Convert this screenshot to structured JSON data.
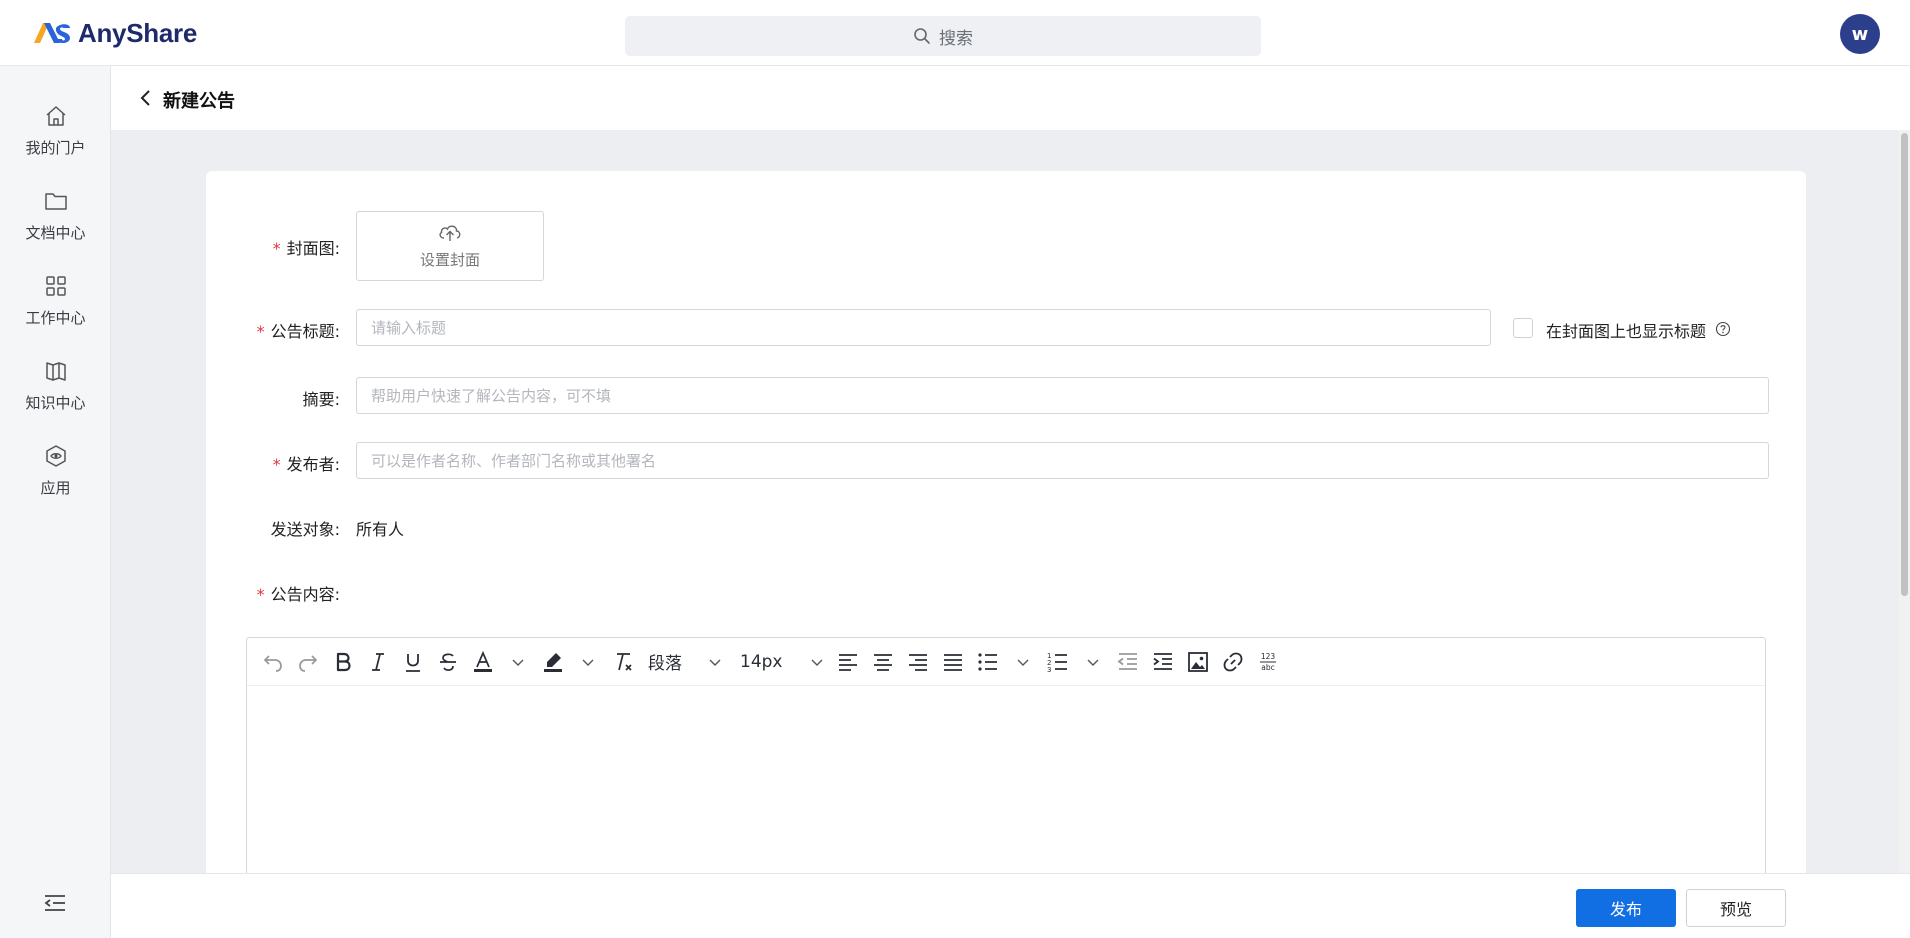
{
  "app": {
    "name": "AnyShare"
  },
  "search": {
    "placeholder": "搜索"
  },
  "user": {
    "avatar_letter": "w",
    "avatar_color": "#2c3f8c"
  },
  "sidebar": {
    "items": [
      {
        "label": "我的门户",
        "icon": "home-icon"
      },
      {
        "label": "文档中心",
        "icon": "folder-icon"
      },
      {
        "label": "工作中心",
        "icon": "grid-icon"
      },
      {
        "label": "知识中心",
        "icon": "book-icon"
      },
      {
        "label": "应用",
        "icon": "apps-hexagon-icon"
      }
    ],
    "collapse_icon": "collapse-menu-icon"
  },
  "page": {
    "title": "新建公告",
    "back_icon": "chevron-left-icon"
  },
  "form": {
    "cover": {
      "label": "封面图:",
      "required": "*",
      "button_text": "设置封面",
      "icon": "cloud-upload-icon"
    },
    "title": {
      "label": "公告标题:",
      "required": "*",
      "placeholder": "请输入标题",
      "checkbox_label": "在封面图上也显示标题",
      "help_icon": "question-circle-icon"
    },
    "summary": {
      "label": "摘要:",
      "placeholder": "帮助用户快速了解公告内容，可不填"
    },
    "publisher": {
      "label": "发布者:",
      "required": "*",
      "placeholder": "可以是作者名称、作者部门名称或其他署名"
    },
    "audience": {
      "label": "发送对象:",
      "value": "所有人"
    },
    "content": {
      "label": "公告内容:",
      "required": "*"
    }
  },
  "editor": {
    "paragraph_select": "段落",
    "font_size_select": "14px"
  },
  "footer": {
    "publish": "发布",
    "preview": "预览"
  },
  "colors": {
    "primary": "#126ee3",
    "required": "#e0343c",
    "brand": "#1f2a6b"
  }
}
